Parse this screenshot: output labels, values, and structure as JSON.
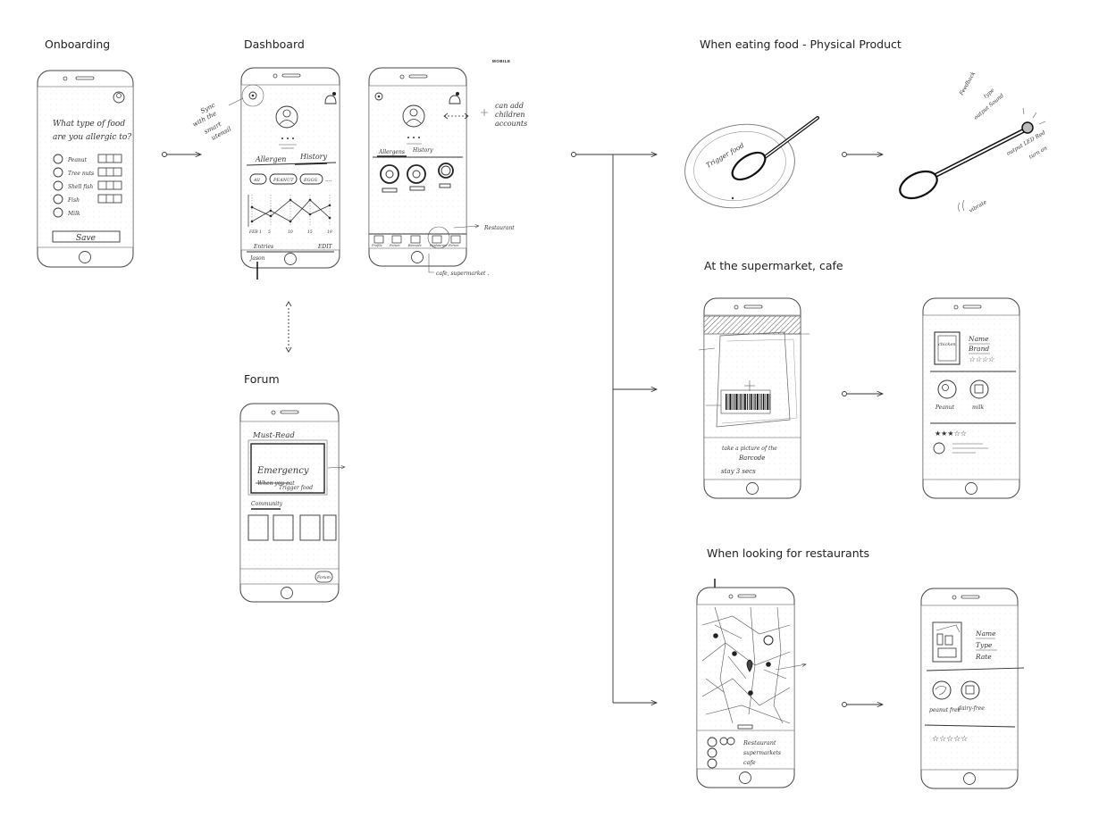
{
  "sections": {
    "onboarding": "Onboarding",
    "dashboard": "Dashboard",
    "forum": "Forum",
    "eating": "When eating food - Physical Product",
    "supermarket": "At the supermarket, cafe",
    "restaurants": "When looking for restaurants"
  },
  "mobile_tag": "MOBILE",
  "onboarding": {
    "question_line1": "What type of food",
    "question_line2": "are you allergic to?",
    "items": [
      "Peanut",
      "Tree nuts",
      "Shell fish",
      "Fish",
      "Milk"
    ],
    "save": "Save"
  },
  "dashboard": {
    "note_sync": [
      "Sync",
      "with the",
      "smart",
      "utensil"
    ],
    "tab_allergens": "Allergen",
    "tab_history": "History",
    "chips": [
      "All",
      "PEANUT",
      "EGGS"
    ],
    "chips_more": "....",
    "x_labels": [
      "FEB 1",
      "5",
      "10",
      "15",
      "19"
    ],
    "entries": "Entries",
    "edit": "EDIT",
    "jason": "Jason"
  },
  "dashboard2": {
    "tab_allergens": "Allergens",
    "tab_history": "History",
    "note_children": [
      "can add",
      "children",
      "accounts"
    ],
    "nav": [
      "Profile",
      "Forum",
      "Barcode",
      "Restaurant",
      "Forum"
    ],
    "note_restaurant": "Restaurant",
    "note_cafe": "cafe, supermarket ."
  },
  "forum": {
    "must_read": "Must-Read",
    "card_title": "Emergency",
    "card_line": "When you eat",
    "card_sub": "Trigger food",
    "community": "Community",
    "forum_btn": "Forum"
  },
  "eating": {
    "plate_text": "Trigger food",
    "notes": [
      "Feedback",
      "type",
      "output Sound",
      "output LED Red",
      "turn on",
      "vibrate"
    ]
  },
  "supermarket": {
    "instruction_line1": "take a picture of the",
    "instruction_line2": "Barcode",
    "instruction_line3": "stay 3 secs",
    "product_label": "chicken",
    "name": "Name",
    "brand": "Brand",
    "allergen1": "Peanut",
    "allergen2": "milk"
  },
  "restaurants": {
    "list": [
      "Restaurant",
      "supermarkets",
      "cafe"
    ],
    "name": "Name",
    "type": "Type",
    "rate": "Rate",
    "badge1": "peanut free",
    "badge2": "dairy-free"
  }
}
